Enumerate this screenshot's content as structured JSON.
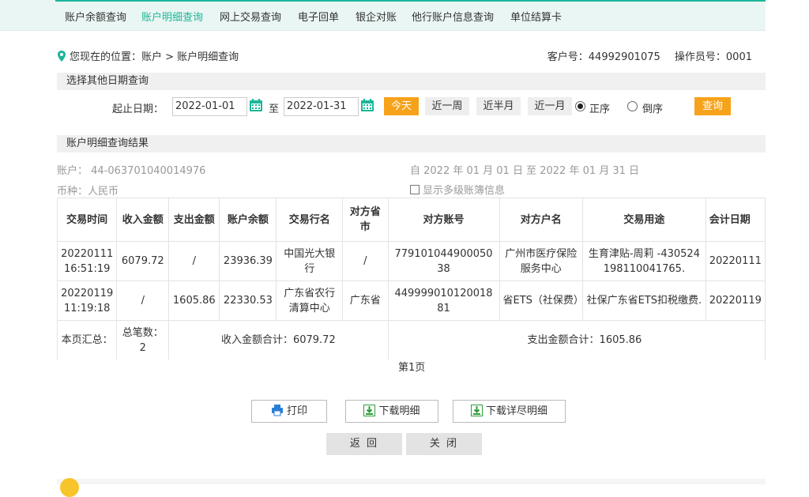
{
  "nav": {
    "items": [
      "账户余额查询",
      "账户明细查询",
      "网上交易查询",
      "电子回单",
      "银企对账",
      "他行账户信息查询",
      "单位结算卡"
    ],
    "active": "账户明细查询"
  },
  "breadcrumb": "您现在的位置：账户 > 账户明细查询",
  "customer": {
    "customer_no": "客户号：44992901075",
    "operator_no": "操作员号：0001"
  },
  "date_section": {
    "title": "选择其他日期查询",
    "start_label": "起止日期：",
    "start_date": "2022-01-01",
    "to_label": "至",
    "end_date": "2022-01-31",
    "quick": [
      "今天",
      "近一周",
      "近半月",
      "近一月"
    ],
    "order_asc": "正序",
    "order_desc": "倒序",
    "order_selected": "正序",
    "query_button": "查询"
  },
  "result_section": {
    "title": "账户明细查询结果",
    "account": "账户：  44-063701040014976",
    "period": "自 2022 年 01 月 01 日 至 2022 年 01 月 31 日",
    "currency": "币种：人民币",
    "multi_ledger": "显示多级账簿信息"
  },
  "table": {
    "headers": [
      "交易时间",
      "收入金额",
      "支出金额",
      "账户余额",
      "交易行名",
      "对方省市",
      "对方账号",
      "对方户名",
      "交易用途",
      "会计日期"
    ],
    "rows": [
      [
        "20220111 16:51:19",
        "6079.72",
        "/",
        "23936.39",
        "中国光大银行",
        "/",
        "77910104490005038",
        "广州市医疗保险服务中心",
        "生育津贴-周莉 -430524198110041765.",
        "20220111"
      ],
      [
        "20220119 11:19:18",
        "/",
        "1605.86",
        "22330.53",
        "广东省农行清算中心",
        "广东省",
        "44999901012001881",
        "省ETS（社保费）",
        "社保广东省ETS扣税缴费.",
        "20220119"
      ]
    ],
    "summary": {
      "label": "本页汇总：",
      "count": "总笔数：2",
      "income_total": "收入金额合计：6079.72",
      "expense_total": "支出金额合计：1605.86"
    }
  },
  "pager": "第1页",
  "actions": {
    "print": "打印",
    "download_detail": "下载明细",
    "download_full": "下载详尽明细",
    "back": "返 回",
    "close": "关 闭"
  },
  "colors": {
    "accent": "#1bb69a",
    "orange": "#f7a21b"
  }
}
